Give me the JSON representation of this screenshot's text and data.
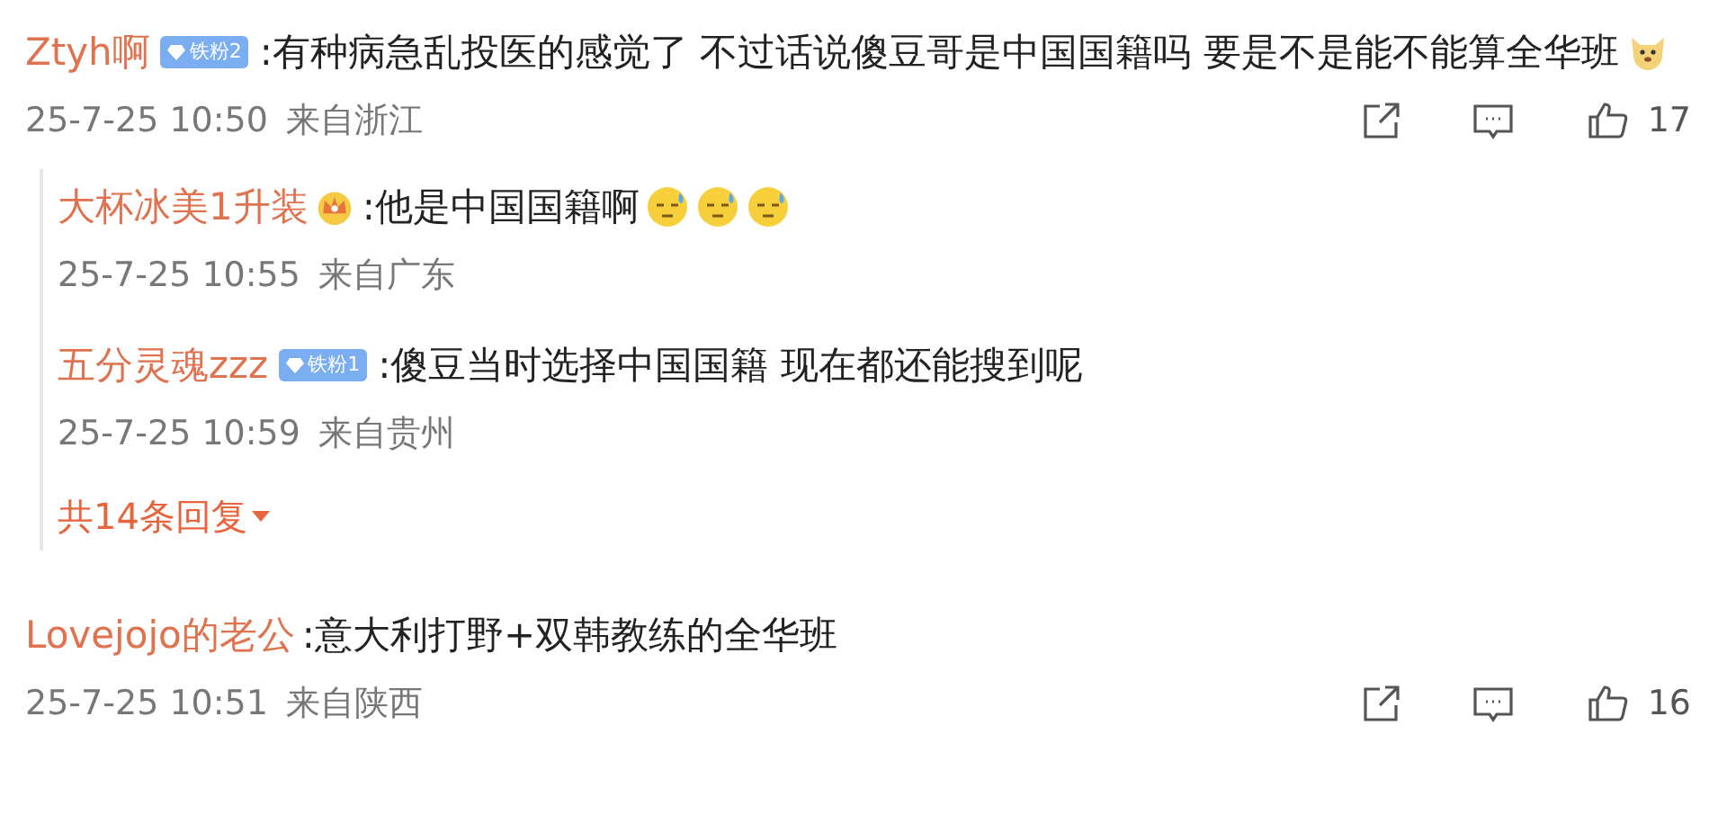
{
  "comments": [
    {
      "author": "Ztyh啊",
      "badge": {
        "kind": "fan",
        "label": "铁粉2"
      },
      "text": ":有种病急乱投医的感觉了 不过话说傻豆哥是中国国籍吗 要是不是能不能算全华班",
      "emoji": [
        {
          "kind": "doge"
        }
      ],
      "time": "25-7-25 10:50",
      "location": "来自浙江",
      "likes": "17",
      "replies": [
        {
          "author": "大杯冰美1升装",
          "badge": {
            "kind": "crown"
          },
          "text": ":他是中国国籍啊",
          "emoji": [
            {
              "kind": "sweat"
            },
            {
              "kind": "sweat"
            },
            {
              "kind": "sweat"
            }
          ],
          "time": "25-7-25 10:55",
          "location": "来自广东"
        },
        {
          "author": "五分灵魂zzz",
          "badge": {
            "kind": "fan",
            "label": "铁粉1"
          },
          "text": ":傻豆当时选择中国国籍 现在都还能搜到呢",
          "time": "25-7-25 10:59",
          "location": "来自贵州"
        }
      ],
      "more_replies": "共14条回复"
    },
    {
      "author": "Lovejojo的老公",
      "text": ":意大利打野+双韩教练的全华班",
      "time": "25-7-25 10:51",
      "location": "来自陕西",
      "likes": "16"
    }
  ]
}
